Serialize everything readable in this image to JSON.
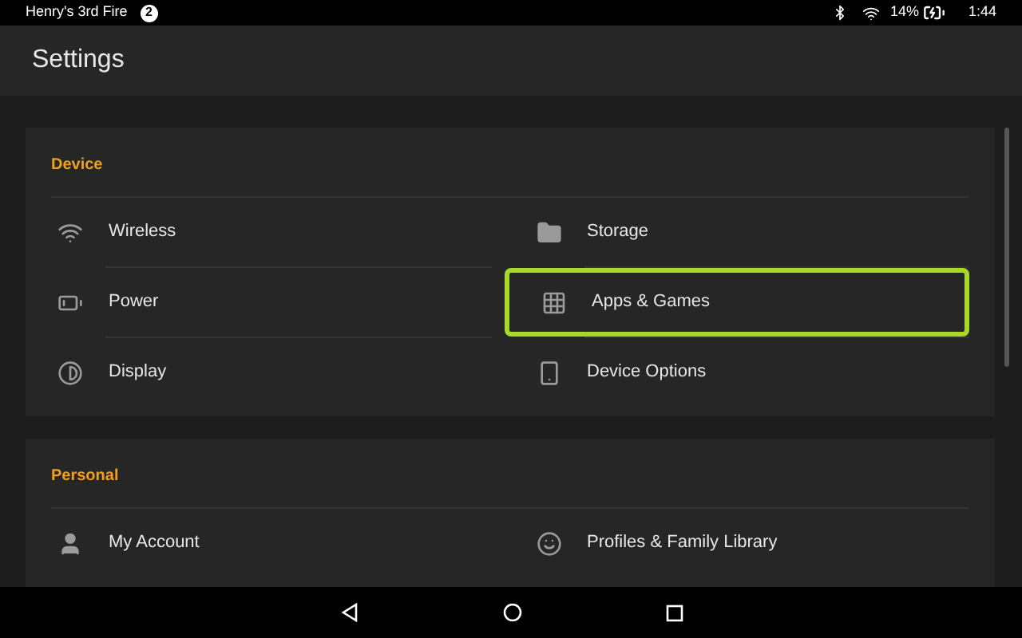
{
  "status_bar": {
    "device_name": "Henry's 3rd Fire",
    "notification_count": "2",
    "battery": "14%",
    "time": "1:44"
  },
  "header": {
    "title": "Settings"
  },
  "sections": [
    {
      "title": "Device",
      "items": [
        {
          "label": "Wireless",
          "kind": "wifi",
          "highlighted": false
        },
        {
          "label": "Storage",
          "kind": "folder",
          "highlighted": false
        },
        {
          "label": "Power",
          "kind": "battery",
          "highlighted": false
        },
        {
          "label": "Apps & Games",
          "kind": "grid",
          "highlighted": true
        },
        {
          "label": "Display",
          "kind": "contrast",
          "highlighted": false
        },
        {
          "label": "Device Options",
          "kind": "phone",
          "highlighted": false
        }
      ]
    },
    {
      "title": "Personal",
      "items": [
        {
          "label": "My Account",
          "kind": "user",
          "highlighted": false
        },
        {
          "label": "Profiles & Family Library",
          "kind": "smile",
          "highlighted": false
        }
      ]
    }
  ]
}
